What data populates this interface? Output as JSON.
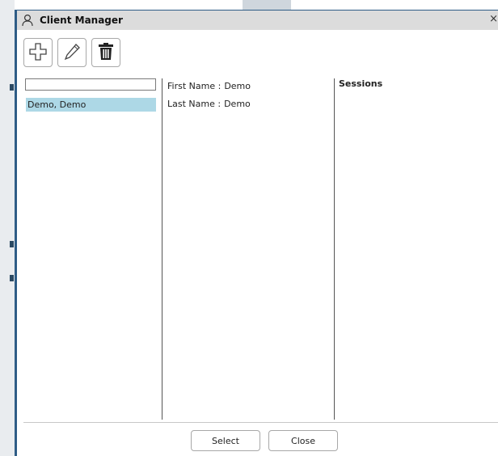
{
  "window": {
    "title": "Client Manager",
    "close_glyph": "×",
    "title_icon": "person-icon"
  },
  "toolbar": {
    "buttons": [
      {
        "name": "add",
        "icon": "plus-icon"
      },
      {
        "name": "edit",
        "icon": "pencil-icon"
      },
      {
        "name": "delete",
        "icon": "trash-icon"
      }
    ]
  },
  "clients": {
    "search_value": "",
    "items": [
      {
        "label": "Demo, Demo",
        "selected": true
      }
    ]
  },
  "details": {
    "first_name_label": "First Name :",
    "first_name_value": "Demo",
    "last_name_label": "Last Name :",
    "last_name_value": "Demo"
  },
  "sessions": {
    "title": "Sessions"
  },
  "footer": {
    "select_label": "Select",
    "close_label": "Close"
  },
  "colors": {
    "selection": "#add8e6",
    "window_border": "#2e5c86",
    "titlebar": "#dcdcdc"
  }
}
